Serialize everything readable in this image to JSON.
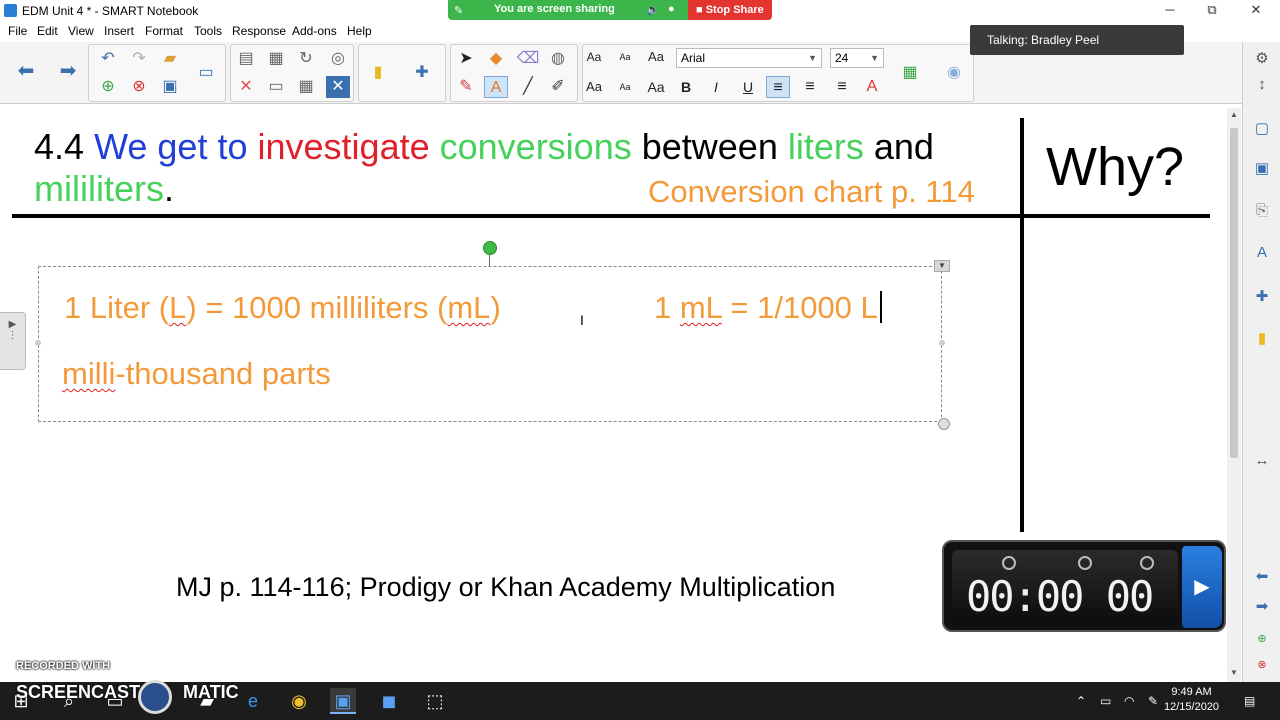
{
  "window": {
    "title": "EDM Unit 4 * - SMART Notebook",
    "minimize": "─",
    "restore": "⧉",
    "close": "✕"
  },
  "share_bar": {
    "status": "You are screen sharing",
    "stop_label": "Stop Share"
  },
  "menu": {
    "items": [
      "File",
      "Edit",
      "View",
      "Insert",
      "Format",
      "Tools",
      "Response",
      "Add-ons",
      "Help"
    ]
  },
  "talking_indicator": "Talking: Bradley Peel",
  "toolbar": {
    "font_family": "Arial",
    "font_size": "24",
    "bold": "B",
    "italic": "I",
    "underline": "U",
    "text_aa": "Aa"
  },
  "slide": {
    "headline": {
      "num": "4.4",
      "we_get_to": "We get to",
      "investigate": "investigate",
      "conversions": "conversions",
      "between": "between",
      "liters": "liters",
      "and": "and",
      "milliliters": "mililiters",
      "period": "."
    },
    "chart_reference": "Conversion chart p. 114",
    "why": "Why?",
    "textbox": {
      "line1_a": "1 Liter (",
      "line1_L": "L",
      "line1_b": ") = 1000 milliliters (",
      "line1_mL": "mL",
      "line1_c": ")",
      "line2_a": "1 ",
      "line2_mL": "mL",
      "line2_b": " = 1/1000 L",
      "line3_milli": "milli",
      "line3_rest": "-thousand parts"
    },
    "assignment": "MJ p. 114-116; Prodigy or Khan Academy Multiplication"
  },
  "timer": {
    "display": "00:00 00"
  },
  "watermark": {
    "recorded_with": "RECORDED WITH",
    "brand_a": "SCREENCAST",
    "brand_b": "MATIC"
  },
  "taskbar": {
    "time": "9:49 AM",
    "date": "12/15/2020"
  }
}
